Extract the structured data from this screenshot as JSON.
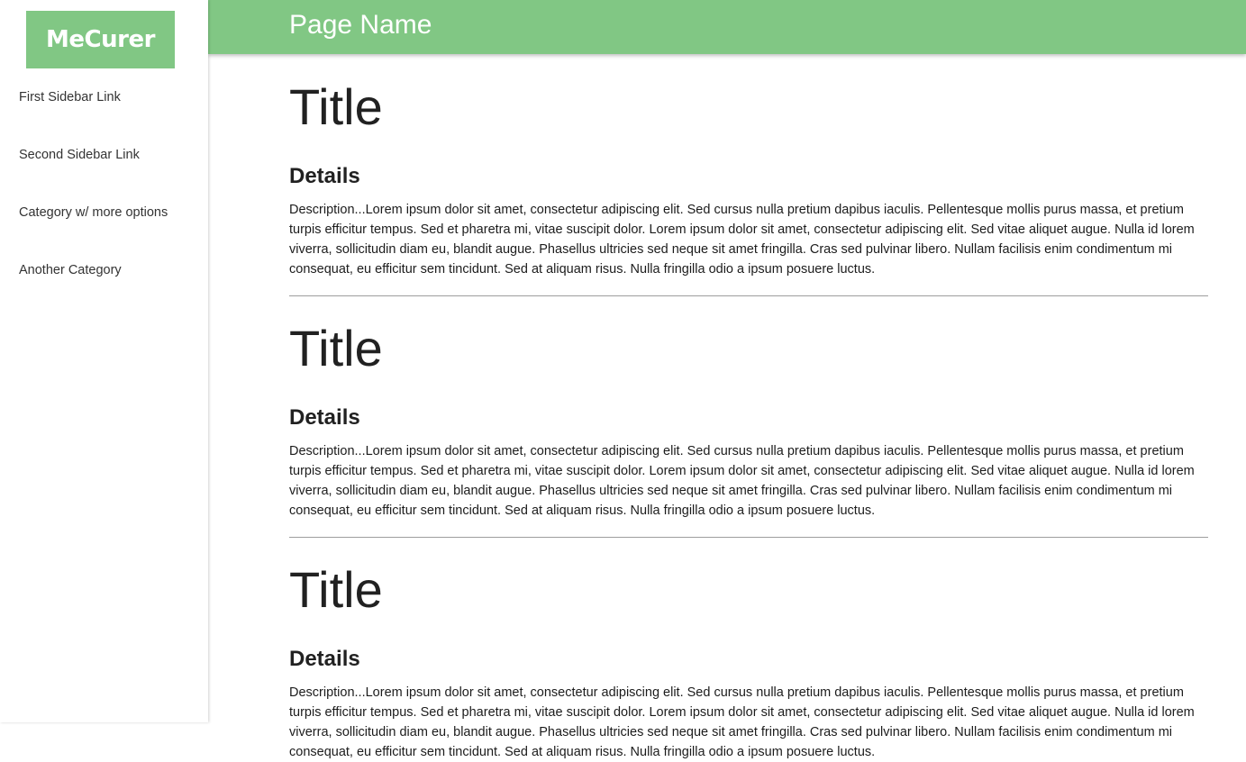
{
  "sidebar": {
    "logo": "MeCurer",
    "items": [
      {
        "label": "First Sidebar Link"
      },
      {
        "label": "Second Sidebar Link"
      },
      {
        "label": "Category w/ more options"
      },
      {
        "label": "Another Category"
      }
    ]
  },
  "header": {
    "page_name": "Page Name"
  },
  "colors": {
    "accent": "#81c784"
  },
  "sections": [
    {
      "title": "Title",
      "details": "Details",
      "description": "Description...Lorem ipsum dolor sit amet, consectetur adipiscing elit. Sed cursus nulla pretium dapibus iaculis. Pellentesque mollis purus massa, et pretium turpis efficitur tempus. Sed et pharetra mi, vitae suscipit dolor. Lorem ipsum dolor sit amet, consectetur adipiscing elit. Sed vitae aliquet augue. Nulla id lorem viverra, sollicitudin diam eu, blandit augue. Phasellus ultricies sed neque sit amet fringilla. Cras sed pulvinar libero. Nullam facilisis enim condimentum mi consequat, eu efficitur sem tincidunt. Sed at aliquam risus. Nulla fringilla odio a ipsum posuere luctus."
    },
    {
      "title": "Title",
      "details": "Details",
      "description": "Description...Lorem ipsum dolor sit amet, consectetur adipiscing elit. Sed cursus nulla pretium dapibus iaculis. Pellentesque mollis purus massa, et pretium turpis efficitur tempus. Sed et pharetra mi, vitae suscipit dolor. Lorem ipsum dolor sit amet, consectetur adipiscing elit. Sed vitae aliquet augue. Nulla id lorem viverra, sollicitudin diam eu, blandit augue. Phasellus ultricies sed neque sit amet fringilla. Cras sed pulvinar libero. Nullam facilisis enim condimentum mi consequat, eu efficitur sem tincidunt. Sed at aliquam risus. Nulla fringilla odio a ipsum posuere luctus."
    },
    {
      "title": "Title",
      "details": "Details",
      "description": "Description...Lorem ipsum dolor sit amet, consectetur adipiscing elit. Sed cursus nulla pretium dapibus iaculis. Pellentesque mollis purus massa, et pretium turpis efficitur tempus. Sed et pharetra mi, vitae suscipit dolor. Lorem ipsum dolor sit amet, consectetur adipiscing elit. Sed vitae aliquet augue. Nulla id lorem viverra, sollicitudin diam eu, blandit augue. Phasellus ultricies sed neque sit amet fringilla. Cras sed pulvinar libero. Nullam facilisis enim condimentum mi consequat, eu efficitur sem tincidunt. Sed at aliquam risus. Nulla fringilla odio a ipsum posuere luctus."
    }
  ]
}
